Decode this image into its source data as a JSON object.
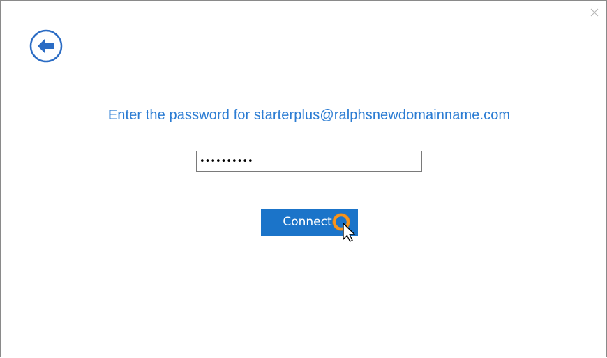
{
  "dialog": {
    "close_icon": "close-icon",
    "back_icon": "back-arrow-icon",
    "prompt": "Enter the password for starterplus@ralphsnewdomainname.com",
    "password": {
      "value": "••••••••••",
      "type": "password"
    },
    "connect_label": "Connect",
    "accent_color": "#2b7cd3",
    "button_color": "#1b74c9"
  },
  "cursor": {
    "icon": "mouse-pointer-icon",
    "highlight_icon": "click-highlight-ring-icon",
    "highlight_color": "#f7941d"
  }
}
